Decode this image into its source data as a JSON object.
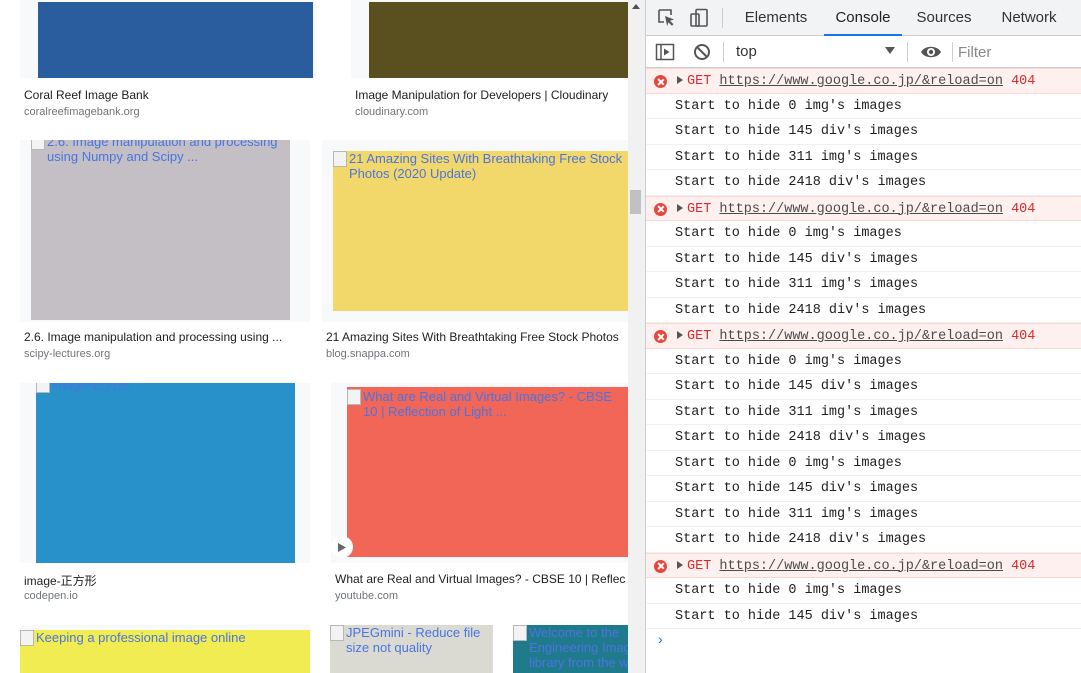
{
  "results": {
    "cards": [
      {
        "title": "Coral Reef Image Bank",
        "source": "coralreefimagebank.org",
        "alt": "",
        "color": "#2a5d9e"
      },
      {
        "title": "Image Manipulation for Developers | Cloudinary",
        "source": "cloudinary.com",
        "alt": "",
        "color": "#5a4f1e"
      },
      {
        "title": "2.6. Image manipulation and processing using ...",
        "source": "scipy-lectures.org",
        "alt": "2.6. Image manipulation and processing using Numpy and Scipy ...",
        "color": "#c3bfc4"
      },
      {
        "title": "21 Amazing Sites With Breathtaking Free Stock Photos",
        "source": "blog.snappa.com",
        "alt": "21 Amazing Sites With Breathtaking Free Stock Photos (2020 Update)",
        "color": "#f2d86b"
      },
      {
        "title": "image-正方形",
        "source": "codepen.io",
        "alt": "image-正方形",
        "color": "#2891c9"
      },
      {
        "title": "What are Real and Virtual Images? - CBSE 10 | Reflec",
        "source": "youtube.com",
        "alt": "What are Real and Virtual Images? - CBSE 10 | Reflection of Light ...",
        "color": "#f16657"
      },
      {
        "title": "",
        "source": "",
        "alt": "Keeping a professional image online",
        "color": "#f1ec52"
      },
      {
        "title": "",
        "source": "",
        "alt": "JPEGmini - Reduce file size not quality",
        "color": "#dadad3"
      },
      {
        "title": "",
        "source": "",
        "alt": "Welcome to the Engineering Image library from the world",
        "color": "#1f7a8c"
      }
    ]
  },
  "devtools": {
    "tabs": [
      "Elements",
      "Console",
      "Sources",
      "Network"
    ],
    "active_tab": "Console",
    "context": "top",
    "filter_placeholder": "Filter",
    "messages": [
      {
        "type": "error",
        "method": "GET",
        "url": "https://www.google.co.jp/&reload=on",
        "code": "404"
      },
      {
        "type": "log",
        "text": "Start to hide 0 img's images"
      },
      {
        "type": "log",
        "text": "Start to hide 145 div's images"
      },
      {
        "type": "log",
        "text": "Start to hide 311 img's images"
      },
      {
        "type": "log",
        "text": "Start to hide 2418 div's images"
      },
      {
        "type": "error",
        "method": "GET",
        "url": "https://www.google.co.jp/&reload=on",
        "code": "404"
      },
      {
        "type": "log",
        "text": "Start to hide 0 img's images"
      },
      {
        "type": "log",
        "text": "Start to hide 145 div's images"
      },
      {
        "type": "log",
        "text": "Start to hide 311 img's images"
      },
      {
        "type": "log",
        "text": "Start to hide 2418 div's images"
      },
      {
        "type": "error",
        "method": "GET",
        "url": "https://www.google.co.jp/&reload=on",
        "code": "404"
      },
      {
        "type": "log",
        "text": "Start to hide 0 img's images"
      },
      {
        "type": "log",
        "text": "Start to hide 145 div's images"
      },
      {
        "type": "log",
        "text": "Start to hide 311 img's images"
      },
      {
        "type": "log",
        "text": "Start to hide 2418 div's images"
      },
      {
        "type": "log",
        "text": "Start to hide 0 img's images"
      },
      {
        "type": "log",
        "text": "Start to hide 145 div's images"
      },
      {
        "type": "log",
        "text": "Start to hide 311 img's images"
      },
      {
        "type": "log",
        "text": "Start to hide 2418 div's images"
      },
      {
        "type": "error",
        "method": "GET",
        "url": "https://www.google.co.jp/&reload=on",
        "code": "404"
      },
      {
        "type": "log",
        "text": "Start to hide 0 img's images"
      },
      {
        "type": "log",
        "text": "Start to hide 145 div's images"
      }
    ],
    "prompt_glyph": "›"
  }
}
